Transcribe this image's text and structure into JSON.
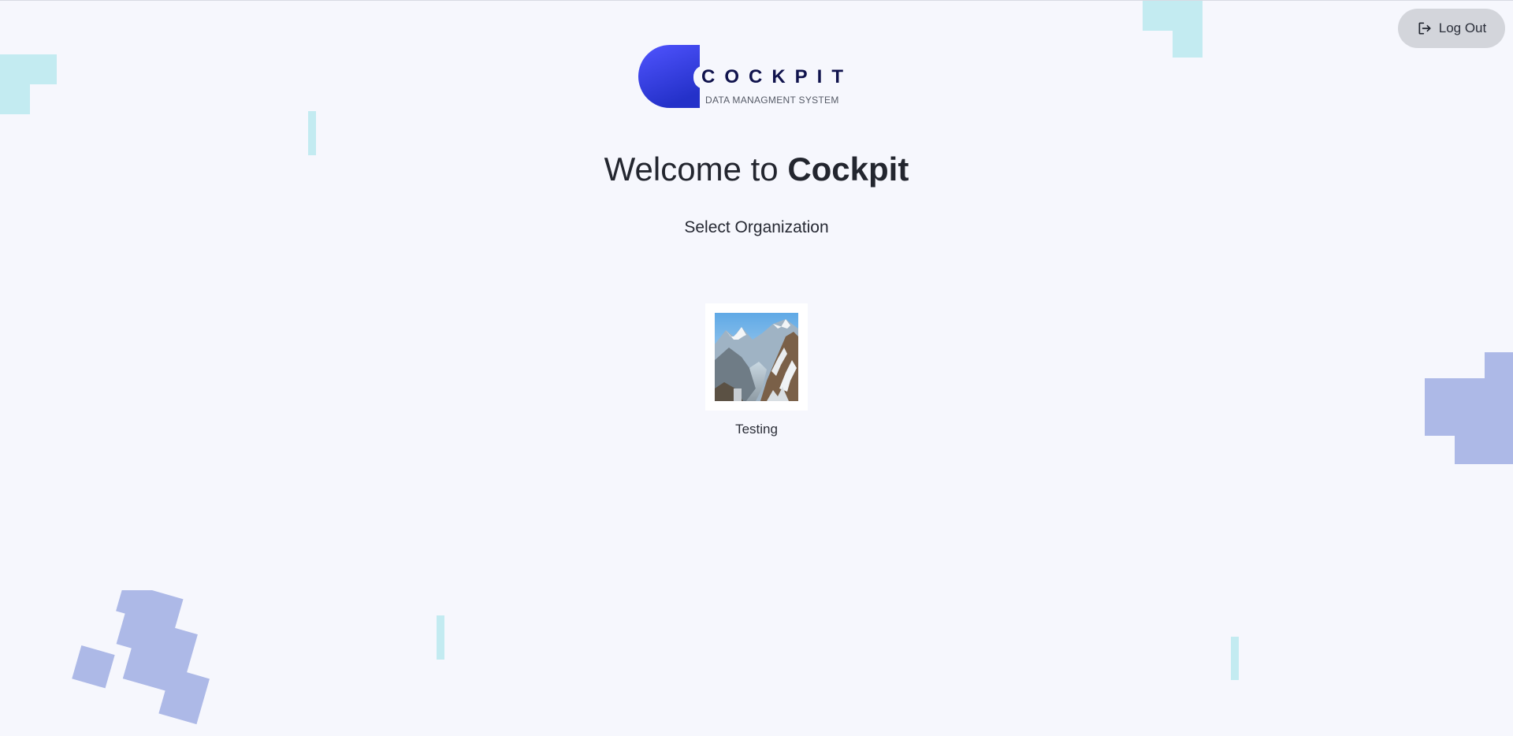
{
  "header": {
    "logout": {
      "label": "Log Out",
      "icon": "logout-icon"
    }
  },
  "brand": {
    "name": "COCKPIT",
    "tagline": "DATA MANAGMENT SYSTEM",
    "gradient_start": "#5054ff",
    "gradient_end": "#2431c9",
    "title_color": "#10134d"
  },
  "welcome": {
    "prefix": "Welcome to ",
    "emphasis": "Cockpit"
  },
  "subtitle": "Select Organization",
  "organizations": [
    {
      "name": "Testing",
      "image": "mountain-landscape-thumbnail"
    }
  ],
  "colors": {
    "background": "#f6f7fd",
    "decor_cyan": "#c3ebf1",
    "decor_blue": "#adb9e7",
    "logout_bg": "#d3d5db"
  }
}
